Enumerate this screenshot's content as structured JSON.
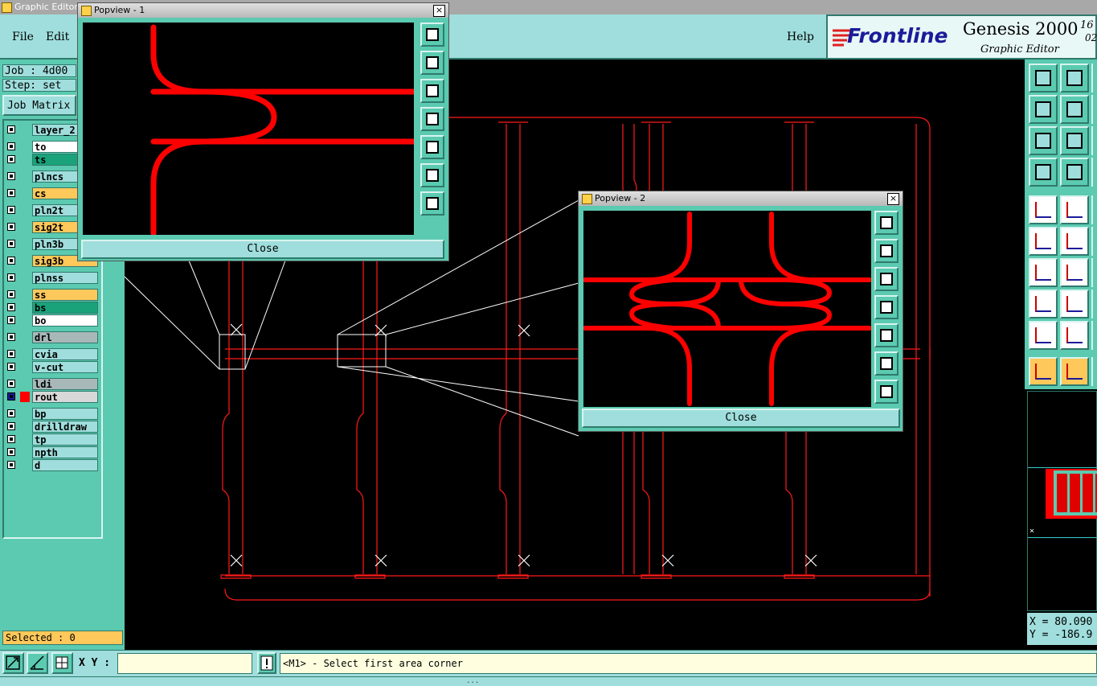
{
  "app": {
    "title": "Graphic Editor"
  },
  "menu": {
    "file": "File",
    "edit": "Edit",
    "help": "Help"
  },
  "brand": {
    "logo": "Frontline",
    "product": "Genesis 2000",
    "subtitle": "Graphic Editor",
    "date_top": "16",
    "date_bottom": "02"
  },
  "job": {
    "job_label": "Job : 4d00",
    "step_label": "Step: set",
    "matrix_button": "Job Matrix"
  },
  "layers": [
    {
      "name": "layer_2",
      "color": "#9fdedc"
    },
    {
      "name": "to",
      "color": "#ffffff"
    },
    {
      "name": "ts",
      "color": "#1aa37a"
    },
    {
      "name": "plncs",
      "color": "#9fdedc"
    },
    {
      "name": "cs",
      "color": "#ffc85a"
    },
    {
      "name": "pln2t",
      "color": "#9fdedc"
    },
    {
      "name": "sig2t",
      "color": "#ffc85a"
    },
    {
      "name": "pln3b",
      "color": "#9fdedc"
    },
    {
      "name": "sig3b",
      "color": "#ffc85a"
    },
    {
      "name": "plnss",
      "color": "#9fdedc"
    },
    {
      "name": "ss",
      "color": "#ffc85a"
    },
    {
      "name": "bs",
      "color": "#1aa37a"
    },
    {
      "name": "bo",
      "color": "#ffffff"
    },
    {
      "name": "drl",
      "color": "#a8b8b8"
    },
    {
      "name": "cvia",
      "color": "#9fdedc"
    },
    {
      "name": "v-cut",
      "color": "#9fdedc"
    },
    {
      "name": "ldi",
      "color": "#a8b8b8"
    },
    {
      "name": "rout",
      "color": "#d8d8d8"
    },
    {
      "name": "bp",
      "color": "#9fdedc"
    },
    {
      "name": "drilldraw",
      "color": "#9fdedc"
    },
    {
      "name": "tp",
      "color": "#9fdedc"
    },
    {
      "name": "npth",
      "color": "#9fdedc"
    },
    {
      "name": "d",
      "color": "#9fdedc"
    }
  ],
  "selected": "Selected : 0",
  "popview1": {
    "title": "Popview - 1",
    "close": "Close"
  },
  "popview2": {
    "title": "Popview - 2",
    "close": "Close"
  },
  "coords": {
    "x": "X = 80.090",
    "y": "Y = -186.9"
  },
  "statusbar": {
    "xy_label": "X Y :",
    "xy_value": "",
    "prompt": "<M1> - Select first area corner"
  },
  "bottom_line": "...",
  "colors": {
    "accent": "#5bcab0",
    "trace": "#ff0000",
    "canvas": "#000000"
  }
}
